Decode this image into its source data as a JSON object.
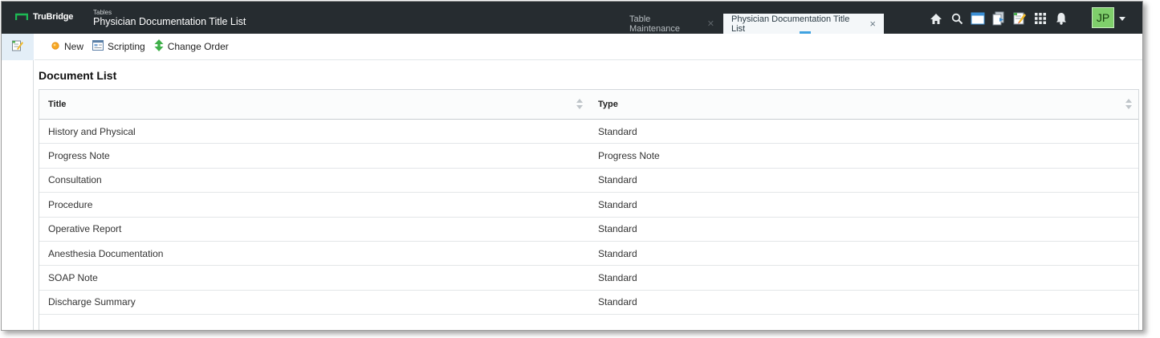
{
  "brand": {
    "name": "TruBridge",
    "mark_color": "#1db954"
  },
  "header": {
    "context": "Tables",
    "title": "Physician Documentation Title List"
  },
  "tabs": [
    {
      "label": "Table Maintenance",
      "active": false
    },
    {
      "label": "Physician Documentation Title List",
      "active": true
    }
  ],
  "top_icons": [
    "home-icon",
    "search-icon",
    "window-icon",
    "documents-icon",
    "notes-icon",
    "apps-grid-icon",
    "bell-icon"
  ],
  "user": {
    "initials": "JP"
  },
  "toolbar": {
    "new_label": "New",
    "scripting_label": "Scripting",
    "change_order_label": "Change Order"
  },
  "section": {
    "title": "Document List"
  },
  "table": {
    "columns": [
      "Title",
      "Type"
    ],
    "rows": [
      [
        "History and Physical",
        "Standard"
      ],
      [
        "Progress Note",
        "Progress Note"
      ],
      [
        "Consultation",
        "Standard"
      ],
      [
        "Procedure",
        "Standard"
      ],
      [
        "Operative Report",
        "Standard"
      ],
      [
        "Anesthesia Documentation",
        "Standard"
      ],
      [
        "SOAP Note",
        "Standard"
      ],
      [
        "Discharge Summary",
        "Standard"
      ]
    ]
  },
  "colors": {
    "topbar": "#262c30",
    "active_tab": "#f4f7f9",
    "avatar": "#7fcf6b",
    "accent": "#3fa2e0"
  }
}
